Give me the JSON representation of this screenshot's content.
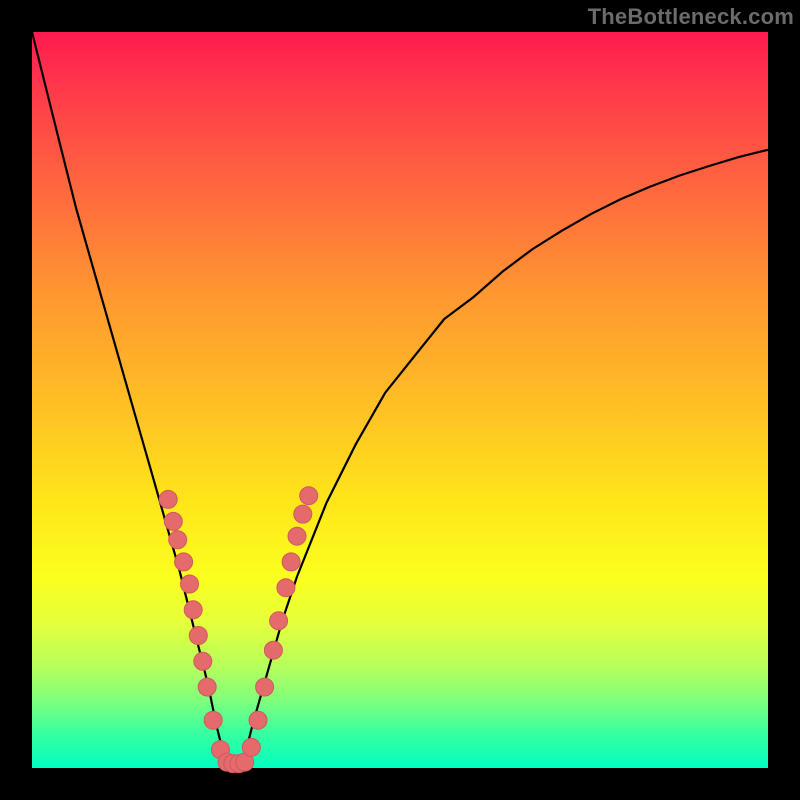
{
  "watermark": "TheBottleneck.com",
  "colors": {
    "frame": "#000000",
    "curve": "#000000",
    "dot_fill": "#e46a6c",
    "dot_stroke": "#cf5a5c",
    "gradient_top": "#ff1a50",
    "gradient_bottom": "#00ffc0"
  },
  "chart_data": {
    "type": "line",
    "title": "",
    "xlabel": "",
    "ylabel": "",
    "xlim": [
      0,
      100
    ],
    "ylim": [
      0,
      100
    ],
    "series": [
      {
        "name": "curve",
        "x": [
          0,
          2,
          4,
          6,
          8,
          10,
          12,
          14,
          16,
          18,
          20,
          22,
          24,
          25,
          26,
          27,
          28,
          29,
          30,
          32,
          34,
          36,
          38,
          40,
          44,
          48,
          52,
          56,
          60,
          64,
          68,
          72,
          76,
          80,
          84,
          88,
          92,
          96,
          100
        ],
        "y": [
          100,
          92,
          84,
          76,
          69,
          62,
          55,
          48,
          41,
          34,
          27,
          19,
          11,
          6,
          2,
          0,
          0,
          2,
          6,
          13,
          20,
          26,
          31,
          36,
          44,
          51,
          56,
          61,
          64,
          67.5,
          70.5,
          73,
          75.3,
          77.3,
          79,
          80.5,
          81.8,
          83,
          84
        ]
      }
    ],
    "marker_points": [
      {
        "x": 18.5,
        "y": 36.5
      },
      {
        "x": 19.2,
        "y": 33.5
      },
      {
        "x": 19.8,
        "y": 31
      },
      {
        "x": 20.6,
        "y": 28
      },
      {
        "x": 21.4,
        "y": 25
      },
      {
        "x": 21.9,
        "y": 21.5
      },
      {
        "x": 22.6,
        "y": 18
      },
      {
        "x": 23.2,
        "y": 14.5
      },
      {
        "x": 23.8,
        "y": 11
      },
      {
        "x": 24.6,
        "y": 6.5
      },
      {
        "x": 25.6,
        "y": 2.5
      },
      {
        "x": 26.5,
        "y": 0.8
      },
      {
        "x": 27.3,
        "y": 0.6
      },
      {
        "x": 28.1,
        "y": 0.6
      },
      {
        "x": 28.9,
        "y": 0.8
      },
      {
        "x": 29.8,
        "y": 2.8
      },
      {
        "x": 30.7,
        "y": 6.5
      },
      {
        "x": 31.6,
        "y": 11
      },
      {
        "x": 32.8,
        "y": 16
      },
      {
        "x": 33.5,
        "y": 20
      },
      {
        "x": 34.5,
        "y": 24.5
      },
      {
        "x": 35.2,
        "y": 28
      },
      {
        "x": 36.0,
        "y": 31.5
      },
      {
        "x": 36.8,
        "y": 34.5
      },
      {
        "x": 37.6,
        "y": 37
      }
    ]
  }
}
